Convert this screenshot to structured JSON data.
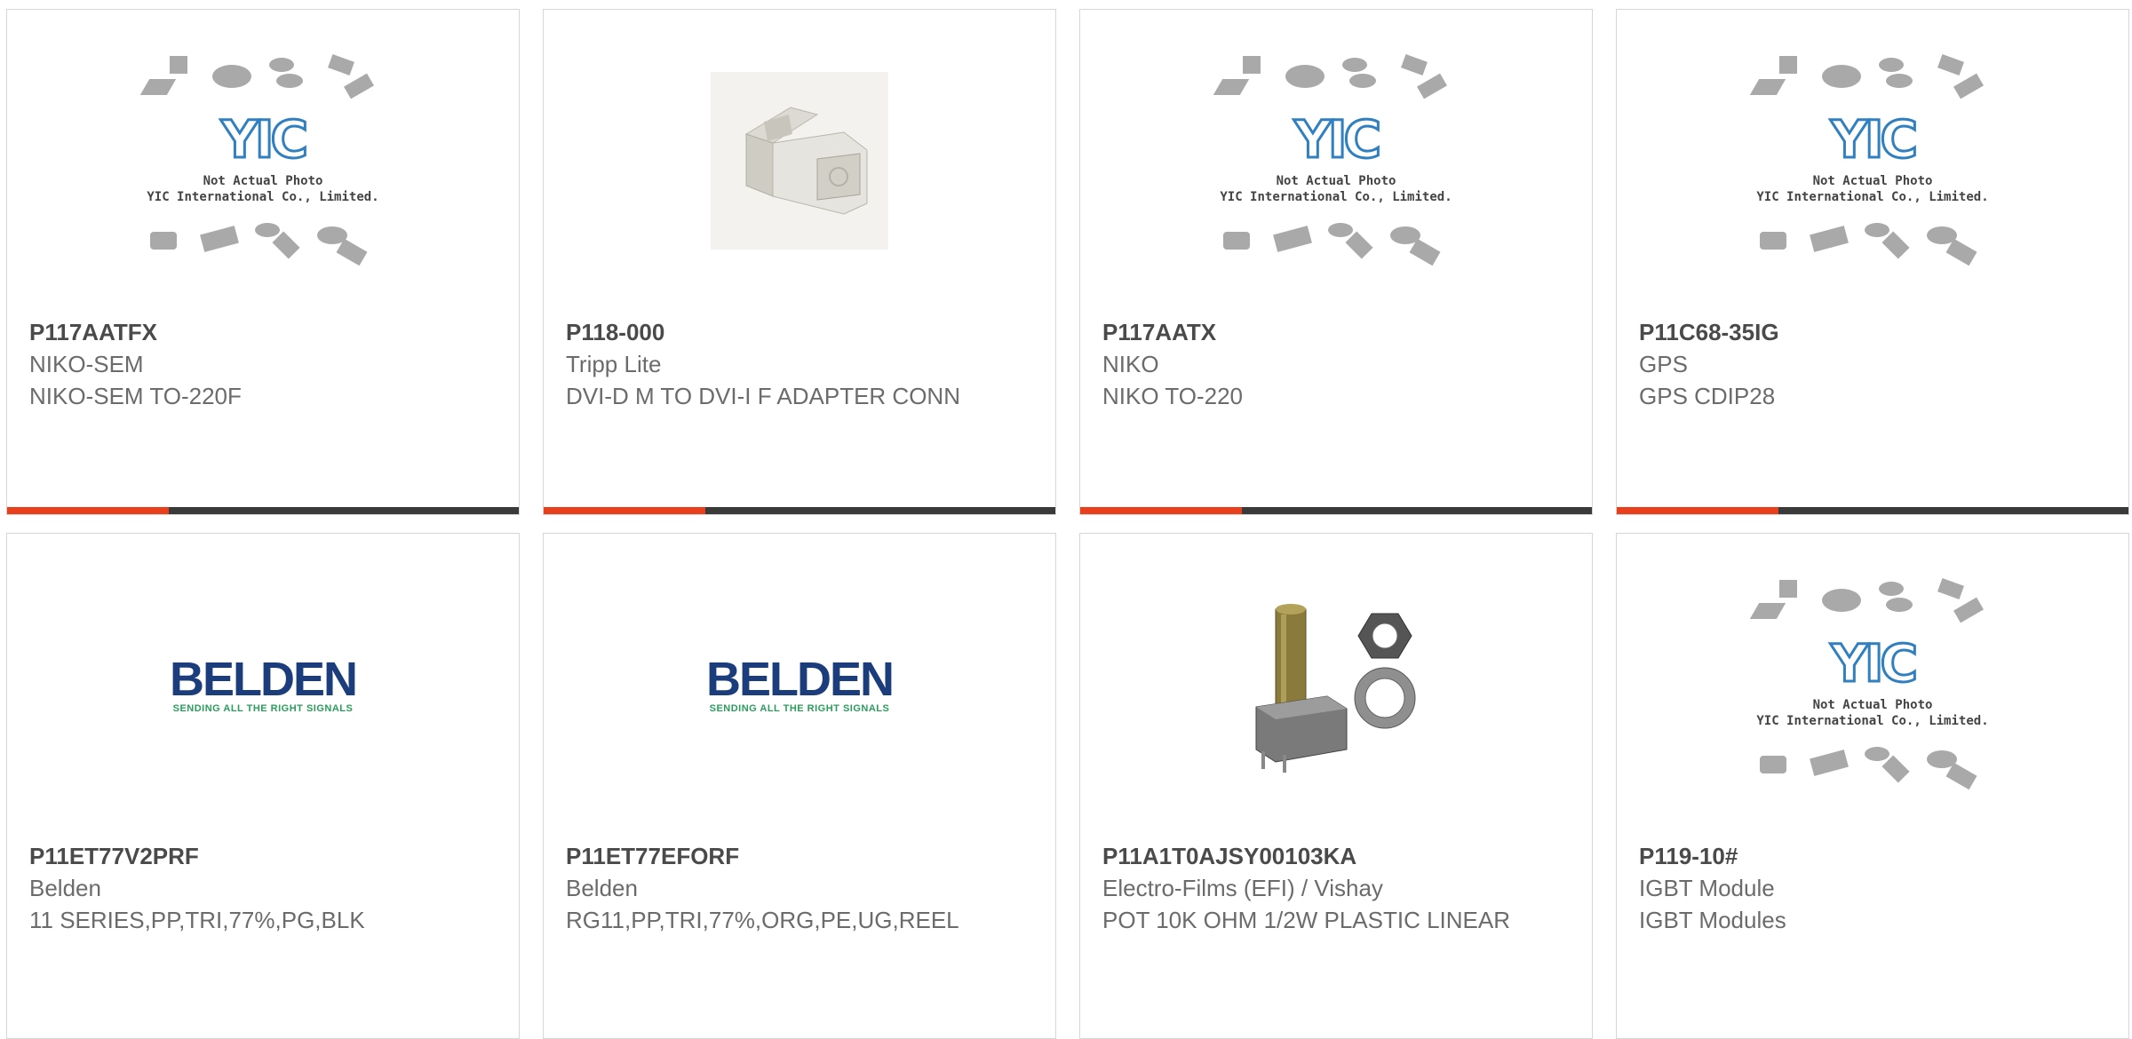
{
  "colors": {
    "accent": "#e8401c",
    "bar": "#3a3a3a"
  },
  "placeholder": {
    "line1": "Not Actual Photo",
    "line2": "YIC International Co., Limited.",
    "logo_text": "YIC"
  },
  "belden_logo": {
    "word": "BELDEN",
    "tagline": "SENDING ALL THE RIGHT SIGNALS"
  },
  "products": [
    {
      "part": "P117AATFX",
      "manufacturer": "NIKO-SEM",
      "description": "NIKO-SEM TO-220F",
      "image": "yic-placeholder"
    },
    {
      "part": "P118-000",
      "manufacturer": "Tripp Lite",
      "description": "DVI-D M TO DVI-I F ADAPTER CONN",
      "image": "dvi-adapter"
    },
    {
      "part": "P117AATX",
      "manufacturer": "NIKO",
      "description": "NIKO TO-220",
      "image": "yic-placeholder"
    },
    {
      "part": "P11C68-35IG",
      "manufacturer": "GPS",
      "description": "GPS CDIP28",
      "image": "yic-placeholder"
    },
    {
      "part": "P11ET77V2PRF",
      "manufacturer": "Belden",
      "description": "11 SERIES,PP,TRI,77%,PG,BLK",
      "image": "belden-logo"
    },
    {
      "part": "P11ET77EFORF",
      "manufacturer": "Belden",
      "description": "RG11,PP,TRI,77%,ORG,PE,UG,REEL",
      "image": "belden-logo"
    },
    {
      "part": "P11A1T0AJSY00103KA",
      "manufacturer": "Electro-Films (EFI) / Vishay",
      "description": "POT 10K OHM 1/2W PLASTIC LINEAR",
      "image": "potentiometer"
    },
    {
      "part": "P119-10#",
      "manufacturer": "IGBT Module",
      "description": "IGBT Modules",
      "image": "yic-placeholder"
    }
  ]
}
